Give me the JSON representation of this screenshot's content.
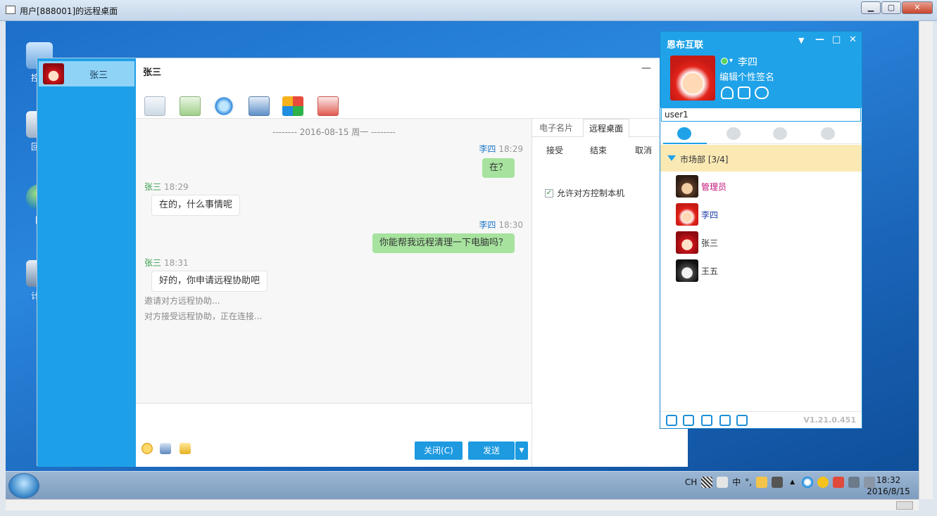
{
  "window": {
    "title": "用户[888001]的远程桌面",
    "min": "▁",
    "max": "▢",
    "close": "✕"
  },
  "desktop": {
    "icons": [
      {
        "label": "控制"
      },
      {
        "label": "回收"
      },
      {
        "label": "网"
      },
      {
        "label": "计算"
      }
    ]
  },
  "taskbar": {
    "tray": {
      "lang": "CH",
      "ime": "中",
      "punct": "°,",
      "up_arrow": "▲"
    },
    "clock": {
      "time": "18:32",
      "date": "2016/8/15"
    }
  },
  "chat": {
    "contact_tab": {
      "name": "张三"
    },
    "header_title": "张三",
    "minimize": "—",
    "date_separator": "-------- 2016-08-15 周一 --------",
    "messages": [
      {
        "sender": "李四",
        "time": "18:29",
        "text": "在？",
        "side": "right"
      },
      {
        "sender": "张三",
        "time": "18:29",
        "text": "在的，什么事情呢",
        "side": "left"
      },
      {
        "sender": "李四",
        "time": "18:30",
        "text": "你能帮我远程清理一下电脑吗？",
        "side": "right"
      },
      {
        "sender": "张三",
        "time": "18:31",
        "text": "好的，你申请远程协助吧",
        "side": "left"
      }
    ],
    "system_lines": [
      "邀请对方远程协助...",
      "对方接受远程协助，正在连接..."
    ],
    "close_button": "关闭(C)",
    "send_button": "发送",
    "send_dropdown": "▼",
    "side_panel": {
      "tabs": [
        "电子名片",
        "远程桌面"
      ],
      "actions": [
        "接受",
        "结束",
        "取消"
      ],
      "checkbox_label": "允许对方控制本机",
      "checkbox_mark": "✓"
    }
  },
  "buddy": {
    "app_name": "恩布互联",
    "ctrl": {
      "menu": "▼",
      "min": "—",
      "max": "□",
      "close": "✕"
    },
    "me": {
      "name": "李四",
      "signature": "编辑个性签名",
      "status_arrow": "▾"
    },
    "search_value": "user1",
    "group": {
      "name": "市场部 [3/4]"
    },
    "members": [
      {
        "name": "管理员",
        "color": "#c2187a"
      },
      {
        "name": "李四",
        "color": "#1f3fa8"
      },
      {
        "name": "张三",
        "color": "#222222"
      },
      {
        "name": "王五",
        "color": "#222222"
      }
    ],
    "version": "V1.21.0.451"
  },
  "colors": {
    "accent": "#1fa2e8",
    "bubble_right": "#a7e39f",
    "group_bg": "#fbe9b4"
  }
}
